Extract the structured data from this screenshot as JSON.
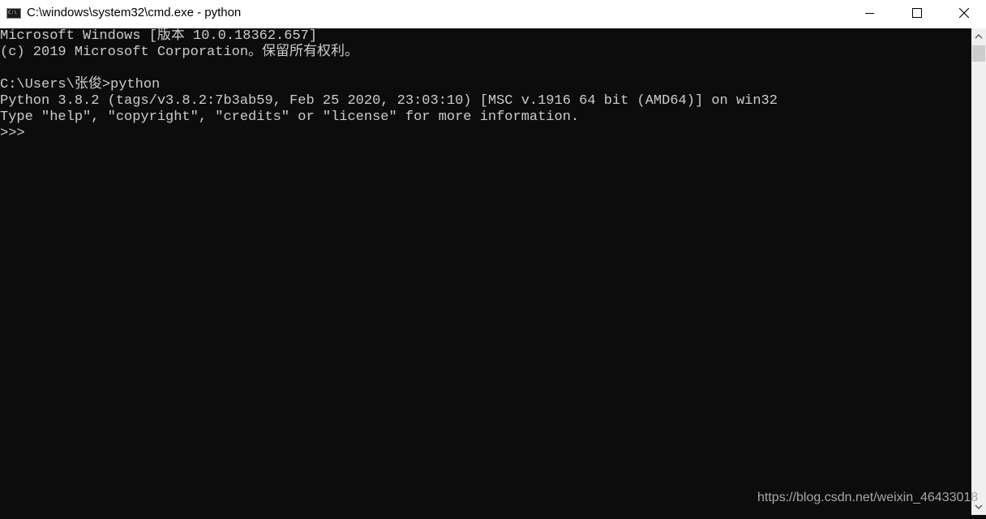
{
  "window": {
    "title": "C:\\windows\\system32\\cmd.exe - python",
    "icon": "cmd-icon",
    "controls": {
      "minimize": "minimize-icon",
      "maximize": "maximize-icon",
      "close": "close-icon"
    }
  },
  "console": {
    "lines": [
      "Microsoft Windows [版本 10.0.18362.657]",
      "(c) 2019 Microsoft Corporation。保留所有权利。",
      "",
      "C:\\Users\\张俊>python",
      "Python 3.8.2 (tags/v3.8.2:7b3ab59, Feb 25 2020, 23:03:10) [MSC v.1916 64 bit (AMD64)] on win32",
      "Type \"help\", \"copyright\", \"credits\" or \"license\" for more information.",
      ">>> "
    ],
    "text_color": "#cccccc",
    "background": "#0c0c0c"
  },
  "watermark": "https://blog.csdn.net/weixin_46433018"
}
